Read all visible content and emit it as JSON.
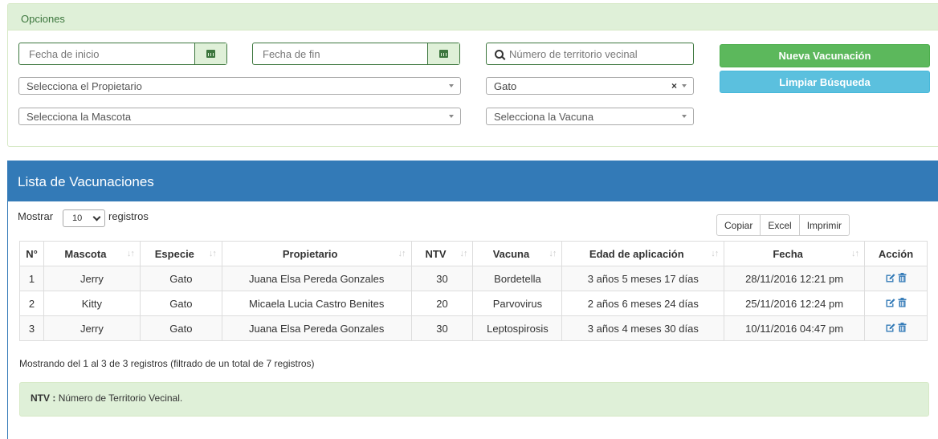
{
  "options": {
    "title": "Opciones",
    "start_date_placeholder": "Fecha de inicio",
    "end_date_placeholder": "Fecha de fin",
    "territory_search_placeholder": "Número de territorio vecinal",
    "owner_select": "Selecciona el Propietario",
    "species_select": "Gato",
    "pet_select": "Selecciona la Mascota",
    "vaccine_select": "Selecciona la Vacuna",
    "new_button": "Nueva Vacunación",
    "clear_button": "Limpiar Búsqueda"
  },
  "list": {
    "title": "Lista de Vacunaciones",
    "show_label": "Mostrar",
    "page_size": "10",
    "records_label": "registros",
    "buttons": [
      "Copiar",
      "Excel",
      "Imprimir"
    ],
    "columns": [
      "N°",
      "Mascota",
      "Especie",
      "Propietario",
      "NTV",
      "Vacuna",
      "Edad de aplicación",
      "Fecha",
      "Acción"
    ],
    "rows": [
      [
        "1",
        "Jerry",
        "Gato",
        "Juana Elsa Pereda Gonzales",
        "30",
        "Bordetella",
        "3 años 5 meses 17 días",
        "28/11/2016 12:21 pm"
      ],
      [
        "2",
        "Kitty",
        "Gato",
        "Micaela Lucia Castro Benites",
        "20",
        "Parvovirus",
        "2 años 6 meses 24 días",
        "25/11/2016 12:24 pm"
      ],
      [
        "3",
        "Jerry",
        "Gato",
        "Juana Elsa Pereda Gonzales",
        "30",
        "Leptospirosis",
        "3 años 4 meses 30 días",
        "10/11/2016 04:47 pm"
      ]
    ],
    "info": "Mostrando del 1 al 3 de 3 registros (filtrado de un total de 7 registros)",
    "note_label": "NTV :",
    "note_text": "Número de Territorio Vecinal."
  },
  "colors": {
    "primary": "#337ab7",
    "success": "#5cb85c",
    "info": "#5bc0de",
    "panel_green": "#dff0d8"
  },
  "icons": {
    "date": "calendar-icon",
    "search": "search-icon",
    "edit": "edit-icon",
    "delete": "trash-icon"
  }
}
